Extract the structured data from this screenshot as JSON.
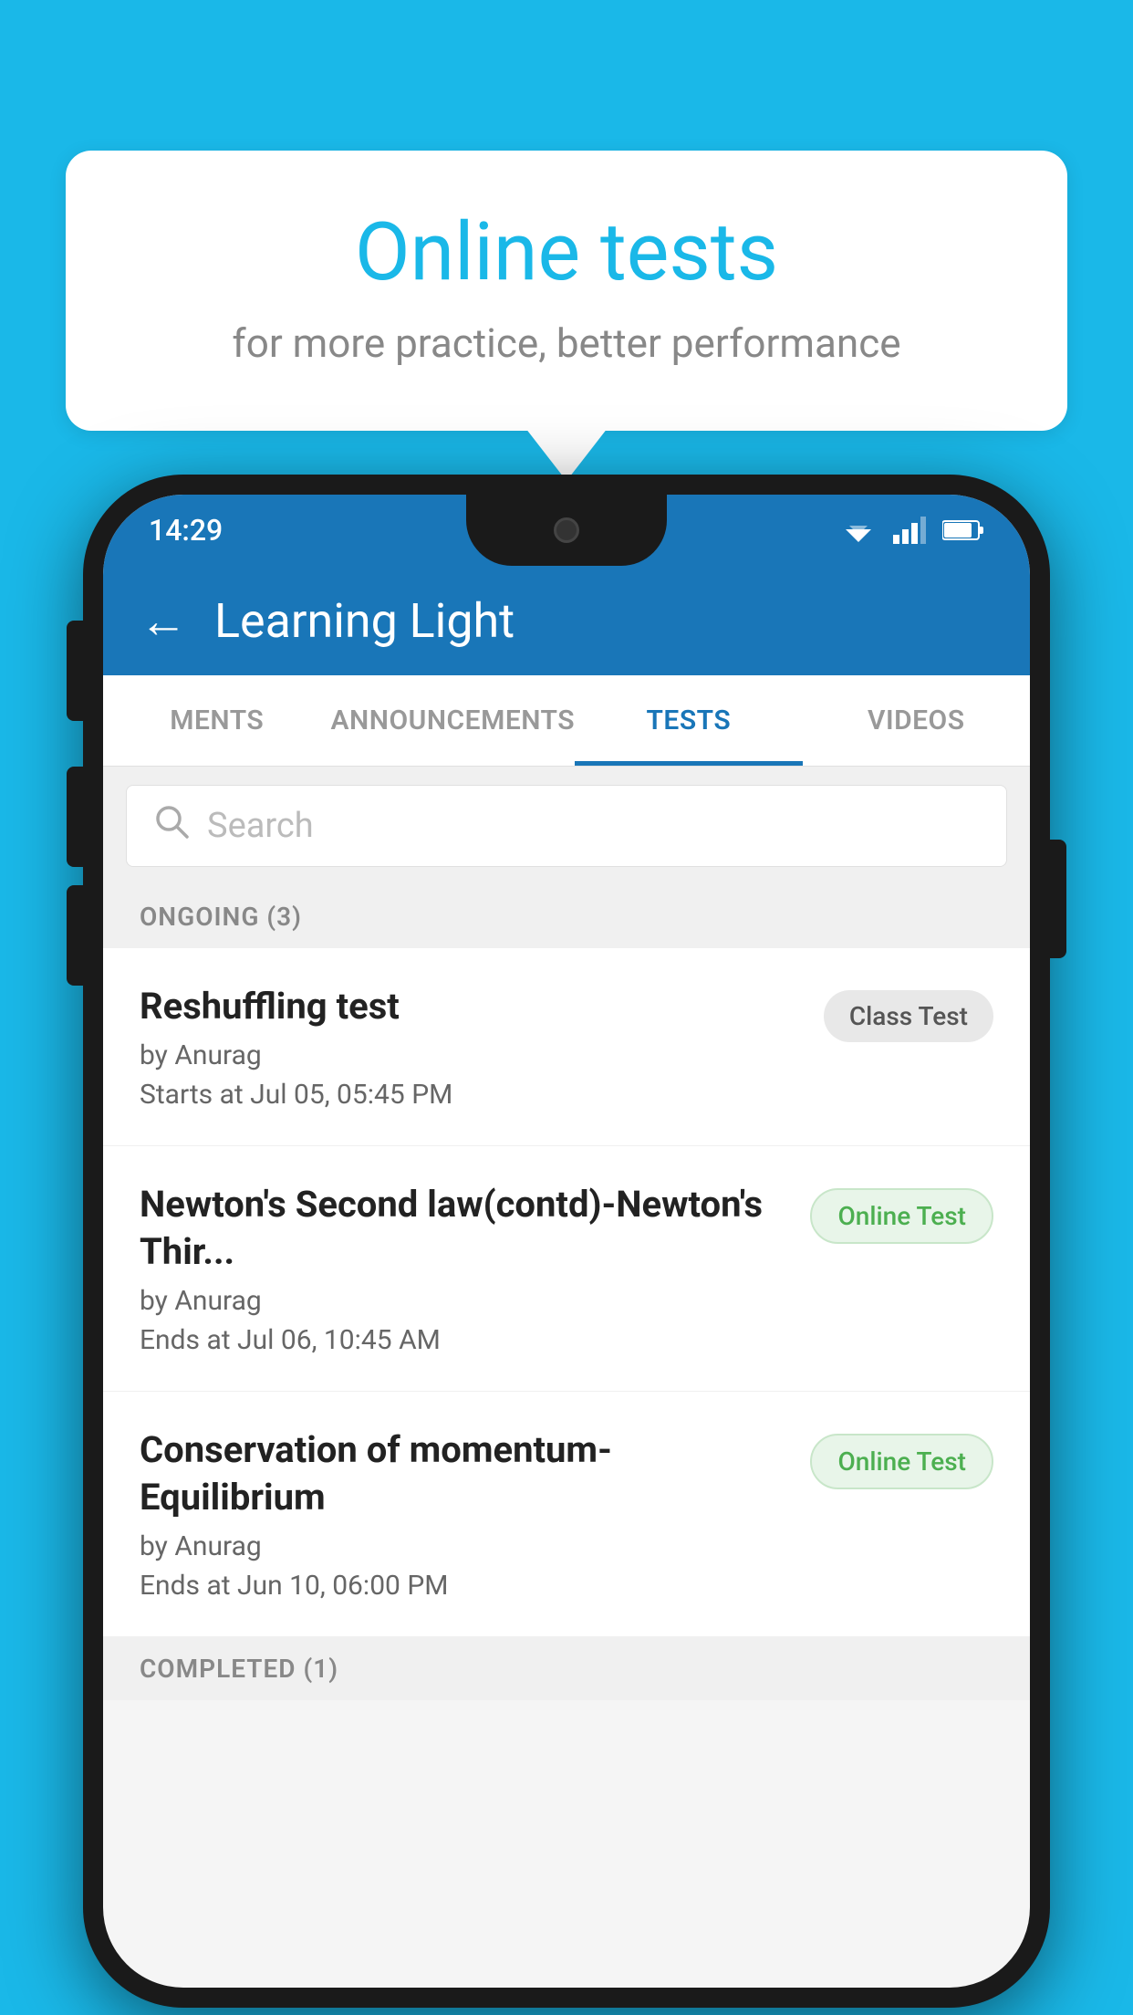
{
  "background": {
    "color": "#1ab8e8"
  },
  "speech_bubble": {
    "title": "Online tests",
    "subtitle": "for more practice, better performance"
  },
  "phone": {
    "status_bar": {
      "time": "14:29"
    },
    "app_bar": {
      "title": "Learning Light",
      "back_label": "←"
    },
    "tabs": [
      {
        "label": "MENTS",
        "active": false
      },
      {
        "label": "ANNOUNCEMENTS",
        "active": false
      },
      {
        "label": "TESTS",
        "active": true
      },
      {
        "label": "VIDEOS",
        "active": false
      }
    ],
    "search": {
      "placeholder": "Search"
    },
    "ongoing_section": {
      "label": "ONGOING (3)"
    },
    "tests": [
      {
        "name": "Reshuffling test",
        "author": "by Anurag",
        "date": "Starts at  Jul 05, 05:45 PM",
        "badge": "Class Test",
        "badge_type": "class"
      },
      {
        "name": "Newton's Second law(contd)-Newton's Thir...",
        "author": "by Anurag",
        "date": "Ends at  Jul 06, 10:45 AM",
        "badge": "Online Test",
        "badge_type": "online"
      },
      {
        "name": "Conservation of momentum-Equilibrium",
        "author": "by Anurag",
        "date": "Ends at  Jun 10, 06:00 PM",
        "badge": "Online Test",
        "badge_type": "online"
      }
    ],
    "completed_section": {
      "label": "COMPLETED (1)"
    }
  }
}
